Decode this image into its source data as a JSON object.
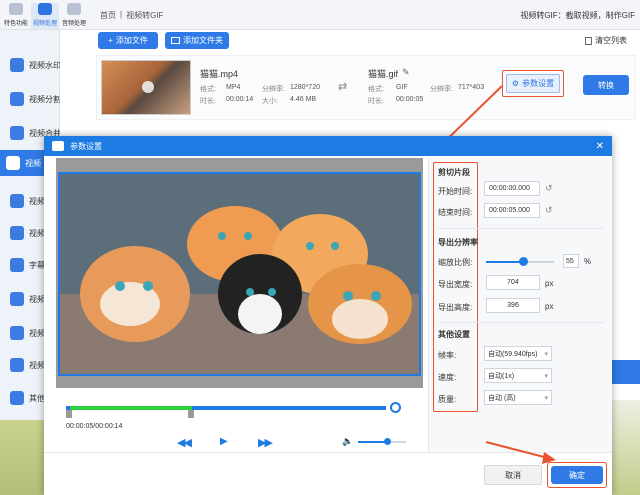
{
  "app": {
    "tabs": [
      {
        "label": "特色功能"
      },
      {
        "label": "视频处理"
      },
      {
        "label": "音频处理"
      }
    ],
    "breadcrumb": {
      "home": "首页",
      "separator": "|",
      "current": "视频转GIF"
    },
    "breadcrumb_right": "视频转GIF：截取视频，制作GIF"
  },
  "sidebar": {
    "items": [
      {
        "label": "视频水印"
      },
      {
        "label": "视频分割"
      },
      {
        "label": "视频合并"
      },
      {
        "label": "视频"
      },
      {
        "label": "视频"
      },
      {
        "label": "视频"
      },
      {
        "label": "字幕"
      },
      {
        "label": "视频"
      },
      {
        "label": "视频"
      },
      {
        "label": "视频"
      },
      {
        "label": "其他"
      }
    ]
  },
  "toolbar": {
    "add_file": "添加文件",
    "add_folder": "添加文件夹",
    "clear_list": "清空列表"
  },
  "file_row": {
    "source_name": "猫猫.mp4",
    "source_format_label": "格式:",
    "source_format": "MP4",
    "source_resolution_label": "分辨率:",
    "source_resolution": "1280*720",
    "source_duration_label": "时长:",
    "source_duration": "00:00:14",
    "source_size_label": "大小:",
    "source_size": "4.46 MB",
    "target_name": "猫猫.gif",
    "target_format_label": "格式:",
    "target_format": "GIF",
    "target_resolution_label": "分辨率:",
    "target_resolution": "717*403",
    "target_duration_label": "时长:",
    "target_duration": "00:00:05",
    "params_button": "参数设置",
    "convert_button": "转换"
  },
  "dialog": {
    "title": "参数设置",
    "time_display": "00:00:05/00:00:14",
    "trim_progress": 0.38,
    "volume_level": 0.6,
    "clip_section": "剪切片段",
    "start_label": "开始时间:",
    "start_value": "00:00:00.000",
    "end_label": "结束时间:",
    "end_value": "00:00:05.000",
    "res_section": "导出分辨率",
    "scale_label": "缩放比例:",
    "scale_value": "55",
    "scale_unit": "%",
    "scale_level": 0.55,
    "width_label": "导出宽度:",
    "width_value": "704",
    "height_label": "导出高度:",
    "height_value": "396",
    "px": "px",
    "other_section": "其他设置",
    "fps_label": "帧率:",
    "fps_value": "自动(59.940fps)",
    "speed_label": "速度:",
    "speed_value": "自动(1x)",
    "quality_label": "质量:",
    "quality_value": "自动 (高)",
    "cancel": "取消",
    "confirm": "确定"
  },
  "colors": {
    "accent": "#2f7ae6",
    "annotation": "#e8542f",
    "trim_green": "#2ecc40"
  }
}
